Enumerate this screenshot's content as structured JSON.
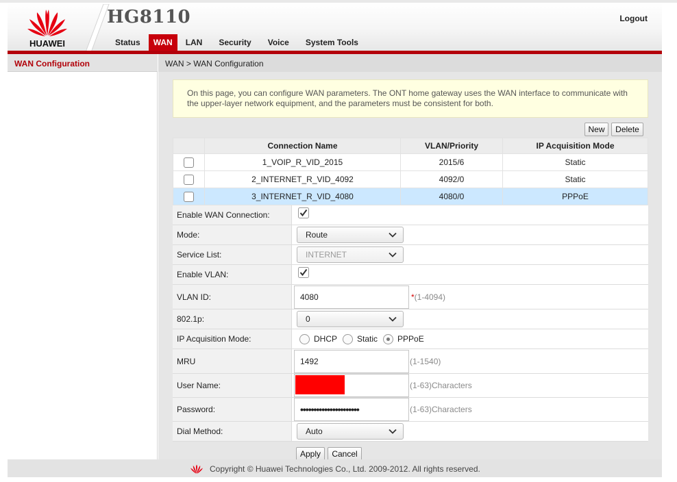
{
  "header": {
    "brand": "HUAWEI",
    "model": "HG8110",
    "logout": "Logout",
    "nav": [
      {
        "label": "Status",
        "active": false
      },
      {
        "label": "WAN",
        "active": true
      },
      {
        "label": "LAN",
        "active": false
      },
      {
        "label": "Security",
        "active": false
      },
      {
        "label": "Voice",
        "active": false
      },
      {
        "label": "System Tools",
        "active": false
      }
    ]
  },
  "sidebar": {
    "active_item": "WAN Configuration"
  },
  "breadcrumb": "WAN > WAN Configuration",
  "notice": "On this page, you can configure WAN parameters. The ONT home gateway uses the WAN interface to communicate with the upper-layer network equipment, and the parameters must be consistent for both.",
  "toolbar": {
    "new_label": "New",
    "delete_label": "Delete"
  },
  "table": {
    "headers": [
      "Connection Name",
      "VLAN/Priority",
      "IP Acquisition Mode"
    ],
    "rows": [
      {
        "name": "1_VOIP_R_VID_2015",
        "vlan": "2015/6",
        "mode": "Static",
        "selected": false
      },
      {
        "name": "2_INTERNET_R_VID_4092",
        "vlan": "4092/0",
        "mode": "Static",
        "selected": false
      },
      {
        "name": "3_INTERNET_R_VID_4080",
        "vlan": "4080/0",
        "mode": "PPPoE",
        "selected": true
      }
    ]
  },
  "form": {
    "enable_wan_label": "Enable WAN Connection:",
    "enable_wan_checked": true,
    "mode_label": "Mode:",
    "mode_value": "Route",
    "service_label": "Service List:",
    "service_value": "INTERNET",
    "enable_vlan_label": "Enable VLAN:",
    "enable_vlan_checked": true,
    "vlan_id_label": "VLAN ID:",
    "vlan_id_value": "4080",
    "vlan_id_required": "*",
    "vlan_id_hint": "(1-4094)",
    "p8021_label": "802.1p:",
    "p8021_value": "0",
    "ip_mode_label": "IP Acquisition Mode:",
    "ip_mode_options": [
      "DHCP",
      "Static",
      "PPPoE"
    ],
    "ip_mode_selected": "PPPoE",
    "mru_label": "MRU",
    "mru_value": "1492",
    "mru_hint": "(1-1540)",
    "username_label": "User Name:",
    "username_hint": "(1-63)Characters",
    "password_label": "Password:",
    "password_value": "••••••••••••••••••••••",
    "password_hint": "(1-63)Characters",
    "dial_label": "Dial Method:",
    "dial_value": "Auto",
    "apply_label": "Apply",
    "cancel_label": "Cancel"
  },
  "footer": {
    "copyright": "Copyright © Huawei Technologies Co., Ltd. 2009-2012. All rights reserved."
  },
  "colors": {
    "brand_red": "#c7000b",
    "selected_row": "#cce8ff",
    "notice_bg": "#ffffe1"
  }
}
